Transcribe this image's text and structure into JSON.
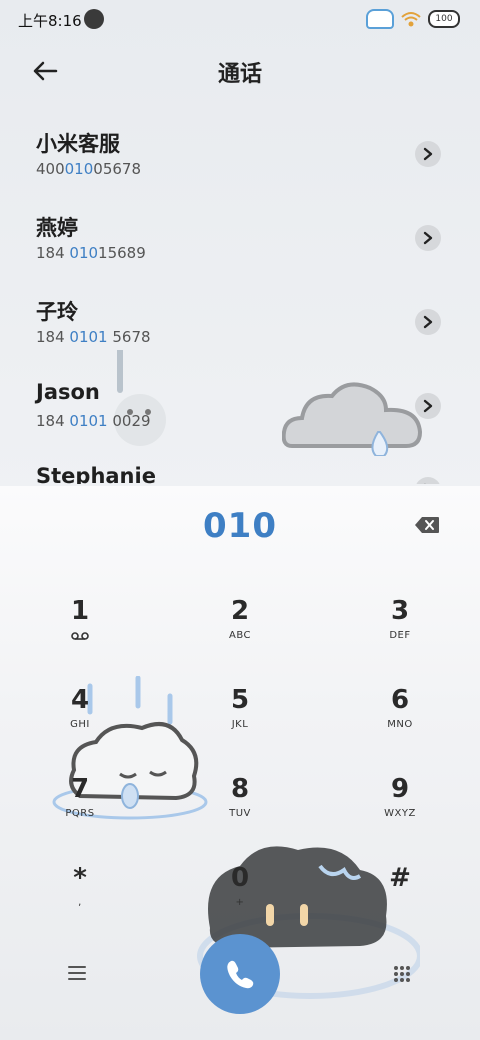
{
  "status_bar": {
    "time": "上午8:16",
    "battery": "100"
  },
  "header": {
    "title": "通话"
  },
  "contacts": [
    {
      "name": "小米客服",
      "num_pre": "400",
      "num_hl": "010",
      "num_post": "05678"
    },
    {
      "name": "燕婷",
      "num_pre": "184 ",
      "num_hl": "010",
      "num_post": "15689"
    },
    {
      "name": "子玲",
      "num_pre": "184 ",
      "num_hl": "0101",
      "num_post": " 5678"
    },
    {
      "name": "Jason",
      "num_pre": "184 ",
      "num_hl": "0101",
      "num_post": " 0029"
    },
    {
      "name": "Stephanie",
      "num_pre": "",
      "num_hl": "",
      "num_post": ""
    }
  ],
  "dialer": {
    "input": "010",
    "keys": [
      {
        "digit": "1",
        "letters": ""
      },
      {
        "digit": "2",
        "letters": "ABC"
      },
      {
        "digit": "3",
        "letters": "DEF"
      },
      {
        "digit": "4",
        "letters": "GHI"
      },
      {
        "digit": "5",
        "letters": "JKL"
      },
      {
        "digit": "6",
        "letters": "MNO"
      },
      {
        "digit": "7",
        "letters": "PQRS"
      },
      {
        "digit": "8",
        "letters": "TUV"
      },
      {
        "digit": "9",
        "letters": "WXYZ"
      },
      {
        "digit": "*",
        "letters": ","
      },
      {
        "digit": "0",
        "letters": "+"
      },
      {
        "digit": "#",
        "letters": ""
      }
    ]
  },
  "icons": {
    "back": "back-arrow-icon",
    "chevron": "chevron-right-icon",
    "delete": "backspace-icon",
    "voicemail": "voicemail-icon",
    "menu": "menu-icon",
    "dialpad": "dialpad-icon",
    "call": "phone-icon"
  },
  "colors": {
    "accent": "#3e7fc4",
    "call_button": "#5b93d0"
  }
}
